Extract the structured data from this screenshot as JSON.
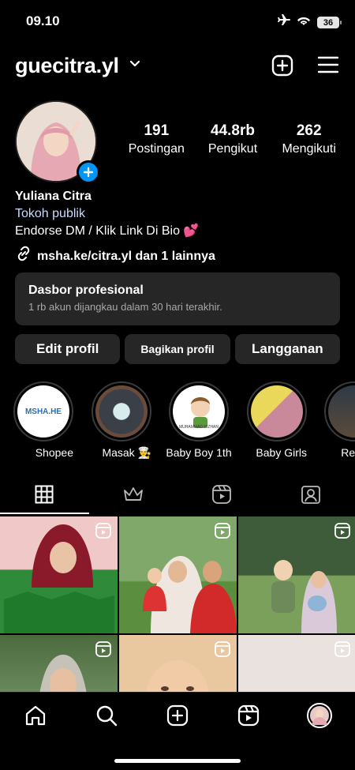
{
  "status_bar": {
    "time": "09.10",
    "battery": "36"
  },
  "header": {
    "username": "guecitra.yl"
  },
  "stats": [
    {
      "num": "191",
      "label": "Postingan"
    },
    {
      "num": "44.8rb",
      "label": "Pengikut"
    },
    {
      "num": "262",
      "label": "Mengikuti"
    }
  ],
  "bio": {
    "name": "Yuliana Citra",
    "category": "Tokoh publik",
    "text": "Endorse DM / Klik Link Di Bio 💕",
    "link": "msha.ke/citra.yl dan 1 lainnya"
  },
  "dashboard": {
    "title": "Dasbor profesional",
    "subtitle": "1 rb akun dijangkau dalam 30 hari terakhir."
  },
  "actions": {
    "edit": "Edit profil",
    "share": "Bagikan profil",
    "subscribe": "Langganan"
  },
  "highlights": [
    {
      "label": "Shopee",
      "cover_text": "MSHA.HE"
    },
    {
      "label": "Masak 👨‍🍳"
    },
    {
      "label": "Baby Boy 1th",
      "cover_text": "MUHAMMAD RIZHAN"
    },
    {
      "label": "Baby Girls"
    },
    {
      "label": "Read"
    }
  ],
  "tabs": [
    "grid-icon",
    "crown-icon",
    "reels-icon",
    "tagged-icon"
  ],
  "colors": {
    "accent": "#0095f6",
    "card": "#262626",
    "muted": "#a8a8a8"
  }
}
